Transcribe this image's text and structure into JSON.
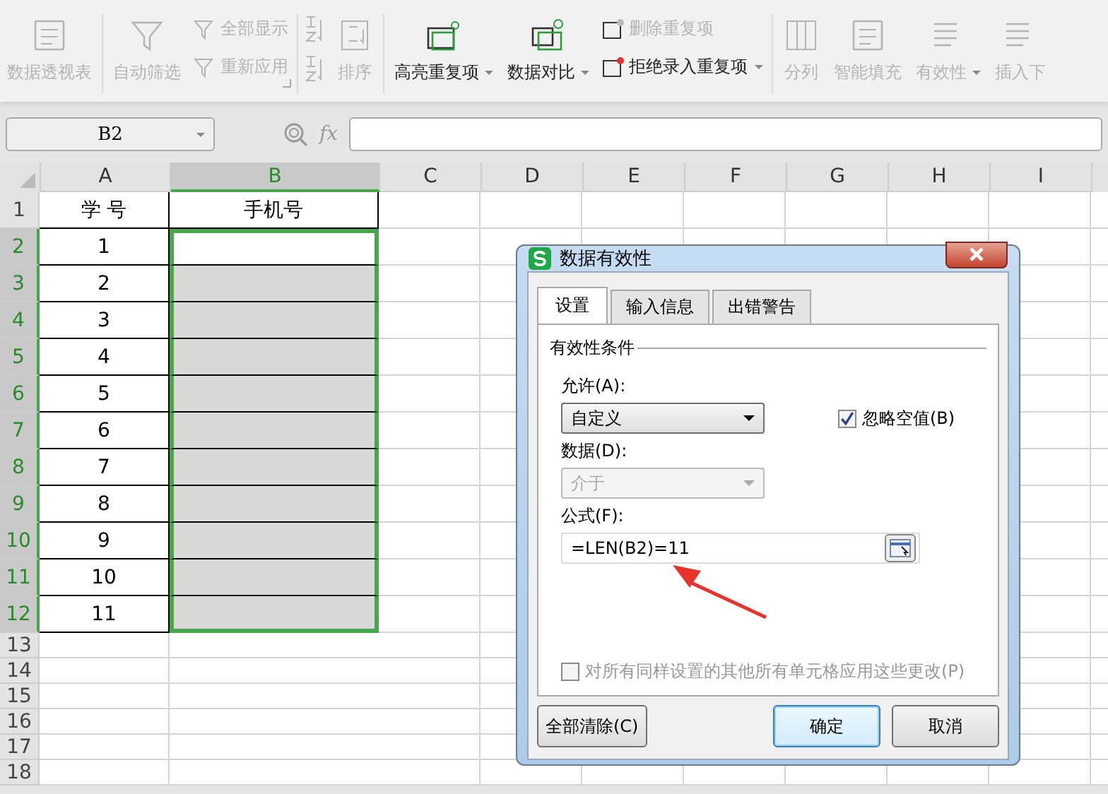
{
  "ribbon": {
    "groups": [
      {
        "items": [
          {
            "kind": "large",
            "label": "数据透视表",
            "disabled": true,
            "dropdown": false
          }
        ]
      },
      {
        "items": [
          {
            "kind": "large",
            "label": "自动筛选",
            "disabled": true,
            "dropdown": false
          },
          {
            "kind": "stack",
            "launcher": true,
            "entries": [
              {
                "label": "全部显示",
                "disabled": true,
                "dropdown": false
              },
              {
                "label": "重新应用",
                "disabled": true,
                "dropdown": false
              }
            ]
          }
        ]
      },
      {
        "items": [
          {
            "kind": "icons",
            "entries": [
              {
                "disabled": true
              },
              {
                "disabled": true
              }
            ]
          },
          {
            "kind": "large",
            "label": "排序",
            "disabled": true,
            "dropdown": false
          }
        ]
      },
      {
        "items": [
          {
            "kind": "large",
            "label": "高亮重复项",
            "disabled": false,
            "dropdown": true
          },
          {
            "kind": "large",
            "label": "数据对比",
            "disabled": false,
            "dropdown": true
          },
          {
            "kind": "stack",
            "entries": [
              {
                "label": "删除重复项",
                "disabled": true,
                "dropdown": false
              },
              {
                "label": "拒绝录入重复项",
                "disabled": false,
                "dropdown": true
              }
            ]
          }
        ]
      },
      {
        "items": [
          {
            "kind": "large",
            "label": "分列",
            "disabled": true,
            "dropdown": false
          },
          {
            "kind": "large",
            "label": "智能填充",
            "disabled": true,
            "dropdown": false
          },
          {
            "kind": "large",
            "label": "有效性",
            "disabled": true,
            "dropdown": true
          },
          {
            "kind": "large",
            "label": "插入下",
            "disabled": true,
            "dropdown": false
          }
        ]
      }
    ]
  },
  "formula_bar": {
    "name_box": "B2",
    "fx_label": "fx"
  },
  "sheet": {
    "columns": [
      {
        "label": "A",
        "selected": false
      },
      {
        "label": "B",
        "selected": true
      },
      {
        "label": "C",
        "selected": false
      },
      {
        "label": "D",
        "selected": false
      },
      {
        "label": "E",
        "selected": false
      },
      {
        "label": "F",
        "selected": false
      },
      {
        "label": "G",
        "selected": false
      },
      {
        "label": "H",
        "selected": false
      },
      {
        "label": "I",
        "selected": false
      }
    ],
    "rows": [
      {
        "label": "1",
        "selected": false,
        "active": false,
        "table_border": true,
        "cells": [
          "学 号",
          "手机号"
        ]
      },
      {
        "label": "2",
        "selected": true,
        "active": true,
        "table_border": true,
        "cells": [
          "1"
        ]
      },
      {
        "label": "3",
        "selected": true,
        "active": false,
        "table_border": true,
        "cells": [
          "2"
        ]
      },
      {
        "label": "4",
        "selected": true,
        "active": false,
        "table_border": true,
        "cells": [
          "3"
        ]
      },
      {
        "label": "5",
        "selected": true,
        "active": false,
        "table_border": true,
        "cells": [
          "4"
        ]
      },
      {
        "label": "6",
        "selected": true,
        "active": false,
        "table_border": true,
        "cells": [
          "5"
        ]
      },
      {
        "label": "7",
        "selected": true,
        "active": false,
        "table_border": true,
        "cells": [
          "6"
        ]
      },
      {
        "label": "8",
        "selected": true,
        "active": false,
        "table_border": true,
        "cells": [
          "7"
        ]
      },
      {
        "label": "9",
        "selected": true,
        "active": false,
        "table_border": true,
        "cells": [
          "8"
        ]
      },
      {
        "label": "10",
        "selected": true,
        "active": false,
        "table_border": true,
        "cells": [
          "9"
        ]
      },
      {
        "label": "11",
        "selected": true,
        "active": false,
        "table_border": true,
        "cells": [
          "10"
        ]
      },
      {
        "label": "12",
        "selected": true,
        "active": false,
        "table_border": true,
        "cells": [
          "11"
        ]
      },
      {
        "label": "13",
        "selected": false,
        "active": false,
        "table_border": false,
        "cells": []
      },
      {
        "label": "14",
        "selected": false,
        "active": false,
        "table_border": false,
        "cells": []
      },
      {
        "label": "15",
        "selected": false,
        "active": false,
        "table_border": false,
        "cells": []
      },
      {
        "label": "16",
        "selected": false,
        "active": false,
        "table_border": false,
        "cells": []
      },
      {
        "label": "17",
        "selected": false,
        "active": false,
        "table_border": false,
        "cells": []
      },
      {
        "label": "18",
        "selected": false,
        "active": false,
        "table_border": false,
        "cells": []
      }
    ]
  },
  "dialog": {
    "title": "数据有效性",
    "tabs": [
      {
        "label": "设置",
        "selected": true
      },
      {
        "label": "输入信息",
        "selected": false
      },
      {
        "label": "出错警告",
        "selected": false
      }
    ],
    "group_label": "有效性条件",
    "allow": {
      "label": "允许(A):",
      "value": "自定义",
      "disabled": false
    },
    "ignore_blank": {
      "label": "忽略空值(B)",
      "checked": true,
      "disabled": false
    },
    "data": {
      "label": "数据(D):",
      "value": "介于",
      "disabled": true
    },
    "formula": {
      "label": "公式(F):",
      "value": "=LEN(B2)=11"
    },
    "apply_all": {
      "label": "对所有同样设置的其他所有单元格应用这些更改(P)",
      "checked": false,
      "disabled": true
    },
    "buttons": [
      {
        "label": "全部清除(C)",
        "default": false
      },
      {
        "label": "确定",
        "default": true
      },
      {
        "label": "取消",
        "default": false
      }
    ]
  }
}
